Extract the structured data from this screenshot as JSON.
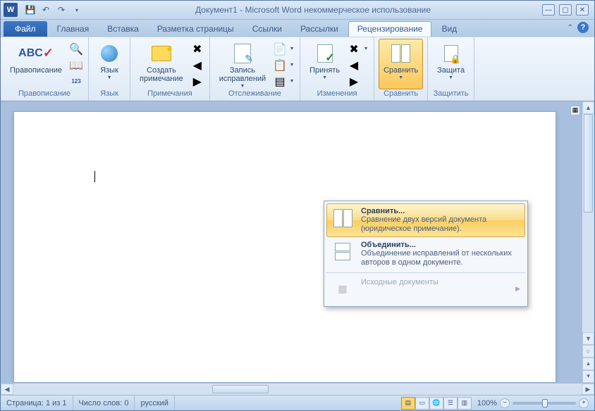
{
  "title": "Документ1 - Microsoft Word некоммерческое использование",
  "qat_word_letter": "W",
  "tabs": {
    "file": "Файл",
    "items": [
      "Главная",
      "Вставка",
      "Разметка страницы",
      "Ссылки",
      "Рассылки",
      "Рецензирование",
      "Вид"
    ],
    "active_index": 5
  },
  "ribbon": {
    "groups": {
      "proofing": {
        "label": "Правописание",
        "spelling": "Правописание"
      },
      "language": {
        "label": "Язык",
        "language": "Язык"
      },
      "comments": {
        "label": "Примечания",
        "new_comment_l1": "Создать",
        "new_comment_l2": "примечание"
      },
      "tracking": {
        "label": "Отслеживание",
        "track_l1": "Запись",
        "track_l2": "исправлений"
      },
      "changes": {
        "label": "Изменения",
        "accept": "Принять"
      },
      "compare": {
        "label": "Сравнить",
        "compare": "Сравнить"
      },
      "protect": {
        "label": "Защитить",
        "protect": "Защита"
      }
    }
  },
  "compare_menu": {
    "compare": {
      "title": "Сравнить...",
      "desc": "Сравнение двух версий документа (юридическое примечание)."
    },
    "combine": {
      "title": "Объединить...",
      "desc": "Объединение исправлений от нескольких авторов в одном документе."
    },
    "source": "Исходные документы"
  },
  "statusbar": {
    "page": "Страница: 1 из 1",
    "words": "Число слов: 0",
    "lang": "русский",
    "zoom": "100%"
  }
}
